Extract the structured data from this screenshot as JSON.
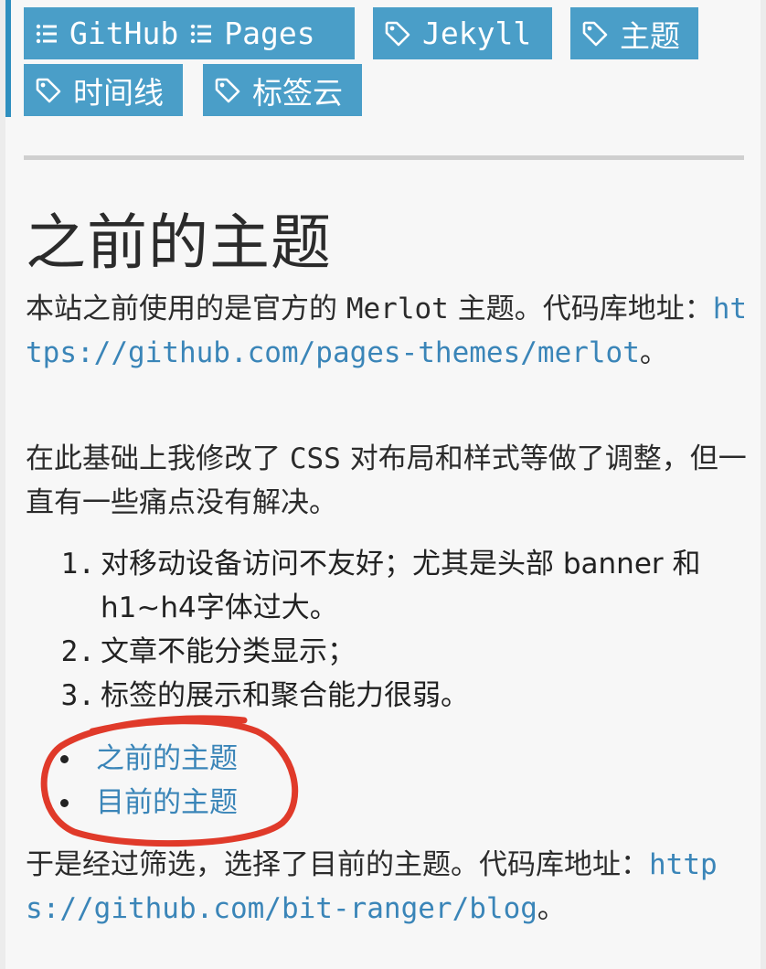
{
  "nav": {
    "tags": [
      {
        "parts": [
          {
            "icon": "list-icon",
            "label": "GitHub"
          },
          {
            "icon": "list-icon",
            "label": "Pages"
          }
        ]
      },
      {
        "parts": [
          {
            "icon": "tag-icon",
            "label": "Jekyll"
          }
        ]
      },
      {
        "parts": [
          {
            "icon": "tag-icon",
            "label": "主题"
          }
        ]
      },
      {
        "parts": [
          {
            "icon": "tag-icon",
            "label": "时间线"
          }
        ]
      },
      {
        "parts": [
          {
            "icon": "tag-icon",
            "label": "标签云"
          }
        ]
      }
    ]
  },
  "article": {
    "heading": "之前的主题",
    "p1": {
      "text": "本站之前使用的是官方的 ",
      "code": "Merlot",
      "text2": " 主题。代码库地址：",
      "link": "https://github.com/pages-themes/merlot",
      "end": "。"
    },
    "p2": {
      "text": "在此基础上我修改了 ",
      "code": "CSS",
      "text2": " 对布局和样式等做了调整，但一直有一些痛点没有解决。"
    },
    "ordered_list": [
      {
        "num": "1.",
        "text": "对移动设备访问不友好；尤其是头部 banner 和 h1~h4字体过大。"
      },
      {
        "num": "2.",
        "text": "文章不能分类显示；"
      },
      {
        "num": "3.",
        "text": "标签的展示和聚合能力很弱。"
      }
    ],
    "toc_links": [
      "之前的主题",
      "目前的主题"
    ],
    "p3": {
      "text": "于是经过筛选，选择了目前的主题。代码库地址：",
      "link": "https://github.com/bit-ranger/blog",
      "end": "。"
    }
  },
  "colors": {
    "tag_bg": "#4a9ec8",
    "link": "#3a85b8",
    "annotation": "#e03a2a"
  }
}
